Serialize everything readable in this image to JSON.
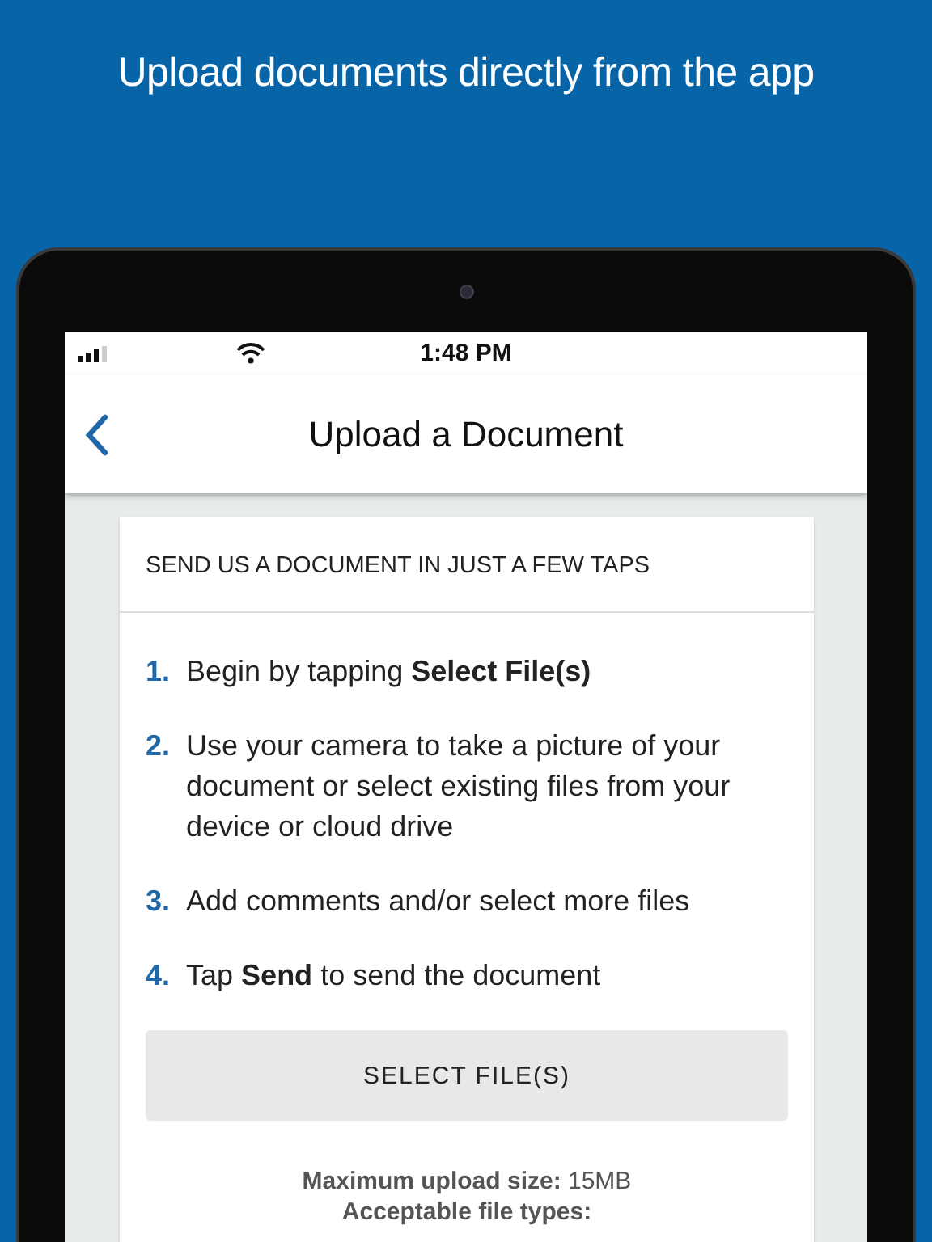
{
  "headline": "Upload documents directly from the app",
  "status_bar": {
    "time": "1:48 PM"
  },
  "nav": {
    "title": "Upload a Document"
  },
  "card": {
    "heading": "SEND US A DOCUMENT IN JUST A FEW TAPS",
    "steps": [
      {
        "number": "1.",
        "text": "Begin by tapping **Select File(s)**"
      },
      {
        "number": "2.",
        "text": "Use your camera to take a picture of your document or select existing files from your device or cloud drive"
      },
      {
        "number": "3.",
        "text": "Add comments and/or select more files"
      },
      {
        "number": "4.",
        "text": "Tap **Send** to send the document"
      }
    ],
    "button": "SELECT FILE(S)",
    "notes": [
      "**Maximum upload size:** 15MB",
      "**Acceptable file types:**"
    ]
  }
}
